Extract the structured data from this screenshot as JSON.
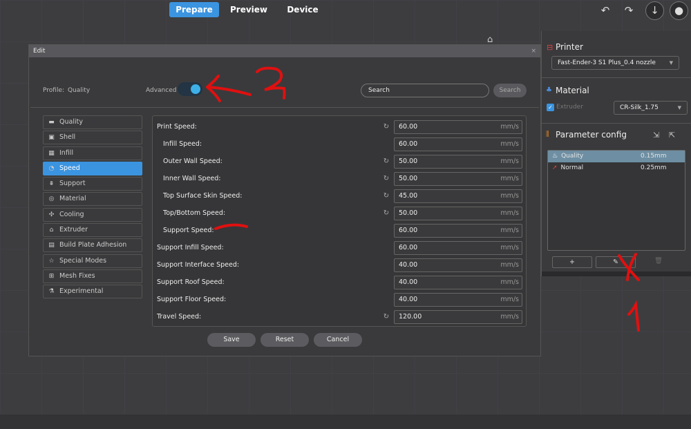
{
  "topbar": {
    "tabs": [
      {
        "label": "Prepare",
        "active": true
      },
      {
        "label": "Preview"
      },
      {
        "label": "Device"
      }
    ],
    "icons": [
      "undo-icon",
      "redo-icon",
      "download-icon",
      "user-icon"
    ]
  },
  "dialog": {
    "title": "Edit",
    "close": "×",
    "profile_label": "Profile:",
    "profile_value": "Quality",
    "advanced_label": "Advanced",
    "advanced_on": true,
    "search_placeholder": "Search",
    "search_button": "Search",
    "categories": [
      {
        "label": "Quality",
        "icon": "▬"
      },
      {
        "label": "Shell",
        "icon": "▣"
      },
      {
        "label": "Infill",
        "icon": "▦"
      },
      {
        "label": "Speed",
        "icon": "◔",
        "active": true
      },
      {
        "label": "Support",
        "icon": "⩩"
      },
      {
        "label": "Material",
        "icon": "◎"
      },
      {
        "label": "Cooling",
        "icon": "✣"
      },
      {
        "label": "Extruder",
        "icon": "⌂"
      },
      {
        "label": "Build Plate Adhesion",
        "icon": "▤"
      },
      {
        "label": "Special Modes",
        "icon": "☆"
      },
      {
        "label": "Mesh Fixes",
        "icon": "⊞"
      },
      {
        "label": "Experimental",
        "icon": "⚗"
      }
    ],
    "settings": [
      {
        "label": "Print Speed:",
        "value": "60.00",
        "unit": "mm/s",
        "indent": false,
        "reset": true
      },
      {
        "label": "Infill Speed:",
        "value": "60.00",
        "unit": "mm/s",
        "indent": true,
        "reset": false
      },
      {
        "label": "Outer Wall Speed:",
        "value": "50.00",
        "unit": "mm/s",
        "indent": true,
        "reset": true
      },
      {
        "label": "Inner Wall Speed:",
        "value": "50.00",
        "unit": "mm/s",
        "indent": true,
        "reset": true
      },
      {
        "label": "Top Surface Skin Speed:",
        "value": "45.00",
        "unit": "mm/s",
        "indent": true,
        "reset": true
      },
      {
        "label": "Top/Bottom Speed:",
        "value": "50.00",
        "unit": "mm/s",
        "indent": true,
        "reset": true
      },
      {
        "label": "Support Speed:",
        "value": "60.00",
        "unit": "mm/s",
        "indent": true,
        "reset": false
      },
      {
        "label": "Support Infill Speed:",
        "value": "60.00",
        "unit": "mm/s",
        "indent": false,
        "reset": false
      },
      {
        "label": "Support Interface Speed:",
        "value": "40.00",
        "unit": "mm/s",
        "indent": false,
        "reset": false
      },
      {
        "label": "Support Roof Speed:",
        "value": "40.00",
        "unit": "mm/s",
        "indent": false,
        "reset": false
      },
      {
        "label": "Support Floor Speed:",
        "value": "40.00",
        "unit": "mm/s",
        "indent": false,
        "reset": false
      },
      {
        "label": "Travel Speed:",
        "value": "120.00",
        "unit": "mm/s",
        "indent": false,
        "reset": true
      }
    ],
    "buttons": {
      "save": "Save",
      "reset": "Reset",
      "cancel": "Cancel"
    }
  },
  "right_panel": {
    "printer_title": "Printer",
    "printer_value": "Fast-Ender-3 S1 Plus_0.4 nozzle",
    "material_title": "Material",
    "extruder_label": "Extruder",
    "extruder_checked": true,
    "material_value": "CR-Silk_1.75",
    "param_title": "Parameter config",
    "profiles": [
      {
        "name": "Quality",
        "height": "0.15mm",
        "selected": true
      },
      {
        "name": "Normal",
        "height": "0.25mm"
      }
    ]
  },
  "annotations": {
    "label_2": "2",
    "label_1": "1",
    "label_x": "X"
  },
  "colors": {
    "accent": "#3b94e0",
    "annotation": "#e01010"
  }
}
